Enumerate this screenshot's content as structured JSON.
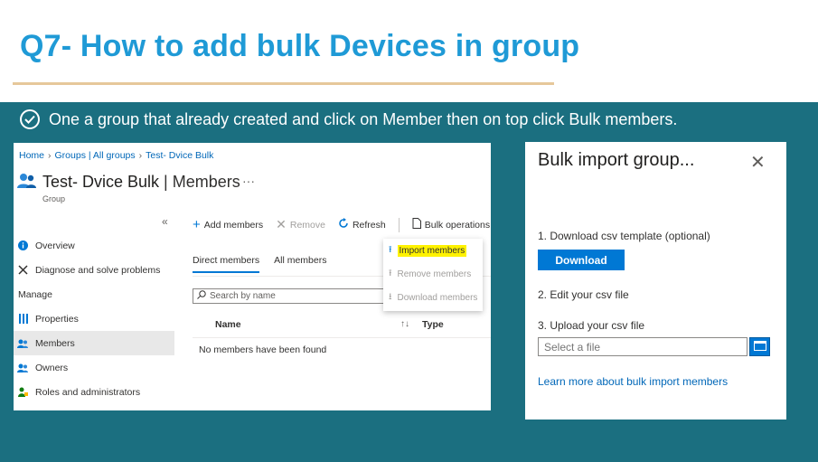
{
  "slide": {
    "title": "Q7- How to add bulk Devices in group",
    "instruction": "One a group that already created and click on Member then on top click Bulk members."
  },
  "portal": {
    "breadcrumb": [
      "Home",
      "Groups | All groups",
      "Test- Dvice Bulk"
    ],
    "title_main": "Test- Dvice Bulk",
    "title_sep": " | ",
    "title_section": "Members",
    "subtitle": "Group",
    "more": "···",
    "collapse": "«",
    "nav": {
      "overview": "Overview",
      "diagnose": "Diagnose and solve problems",
      "manage_heading": "Manage",
      "properties": "Properties",
      "members": "Members",
      "owners": "Owners",
      "roles": "Roles and administrators"
    },
    "toolbar": {
      "add_members": "Add members",
      "remove": "Remove",
      "refresh": "Refresh",
      "bulk_operations": "Bulk operations"
    },
    "tabs": {
      "direct": "Direct members",
      "all": "All members"
    },
    "search_placeholder": "Search by name",
    "columns": {
      "name": "Name",
      "type": "Type"
    },
    "empty_message": "No members have been found",
    "dropdown": {
      "import": "Import members",
      "remove": "Remove members",
      "download": "Download members"
    }
  },
  "bulk_panel": {
    "title": "Bulk import group...",
    "step1": "1. Download csv template (optional)",
    "download_label": "Download",
    "step2": "2. Edit your csv file",
    "step3": "3. Upload your csv file",
    "file_placeholder": "Select a file",
    "learn_more": "Learn more about bulk import members"
  },
  "colors": {
    "title_blue": "#1f9ad6",
    "teal_band": "#1b6f80",
    "azure_blue": "#0078d4",
    "highlight": "#fff200"
  }
}
